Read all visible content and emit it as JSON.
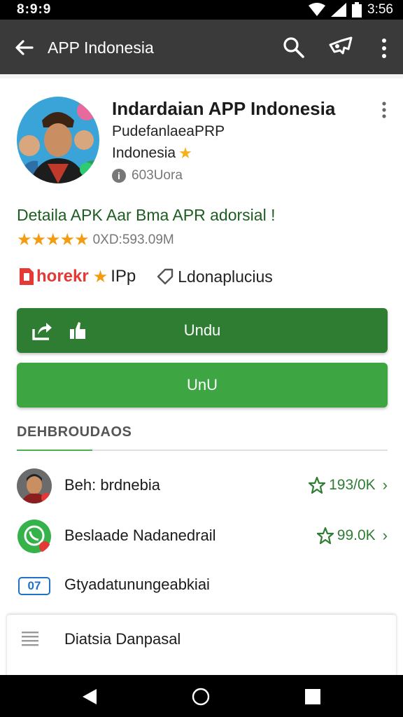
{
  "status_bar": {
    "time": "8:9:9",
    "clock": "3:56"
  },
  "app_bar": {
    "title": "APP Indonesia"
  },
  "app": {
    "name": "Indardaian APP Indonesia",
    "developer_line1": "PudefanlaeaPRP",
    "developer_line2": "Indonesia",
    "size": "603Uora",
    "headline": "Detaila APK Aar Bma APR adorsial !",
    "stars": "★★★★★",
    "rating_text": "0XD:593.09M",
    "brand": "horekr",
    "brand_suffix": "IPp",
    "tag": "Ldonaplucius"
  },
  "buttons": {
    "primary": "Undu",
    "secondary": "UnU"
  },
  "section": {
    "title": "DEHBROUDAOS"
  },
  "list": [
    {
      "label": "Beh: brdnebia",
      "meta": "193/0K"
    },
    {
      "label": "Beslaade Nadanedrail",
      "meta": "99.0K"
    },
    {
      "label": "Gtyadatunungeabkiai",
      "badge": "07"
    }
  ],
  "sheet": {
    "label": "Diatsia Danpasal"
  },
  "colors": {
    "primary_green": "#2e7d32",
    "secondary_green": "#3da643",
    "toolbar": "#3a3a3a",
    "brand_red": "#e53935",
    "star_gold": "#f39c12"
  },
  "icons": [
    "arrow-back-icon",
    "search-icon",
    "share-icon",
    "overflow-menu-icon",
    "info-icon",
    "star-icon",
    "tag-icon",
    "upload-icon",
    "thumbs-up-icon",
    "chevron-right-icon",
    "menu-icon",
    "nav-back-icon",
    "nav-home-icon",
    "nav-recent-icon"
  ]
}
